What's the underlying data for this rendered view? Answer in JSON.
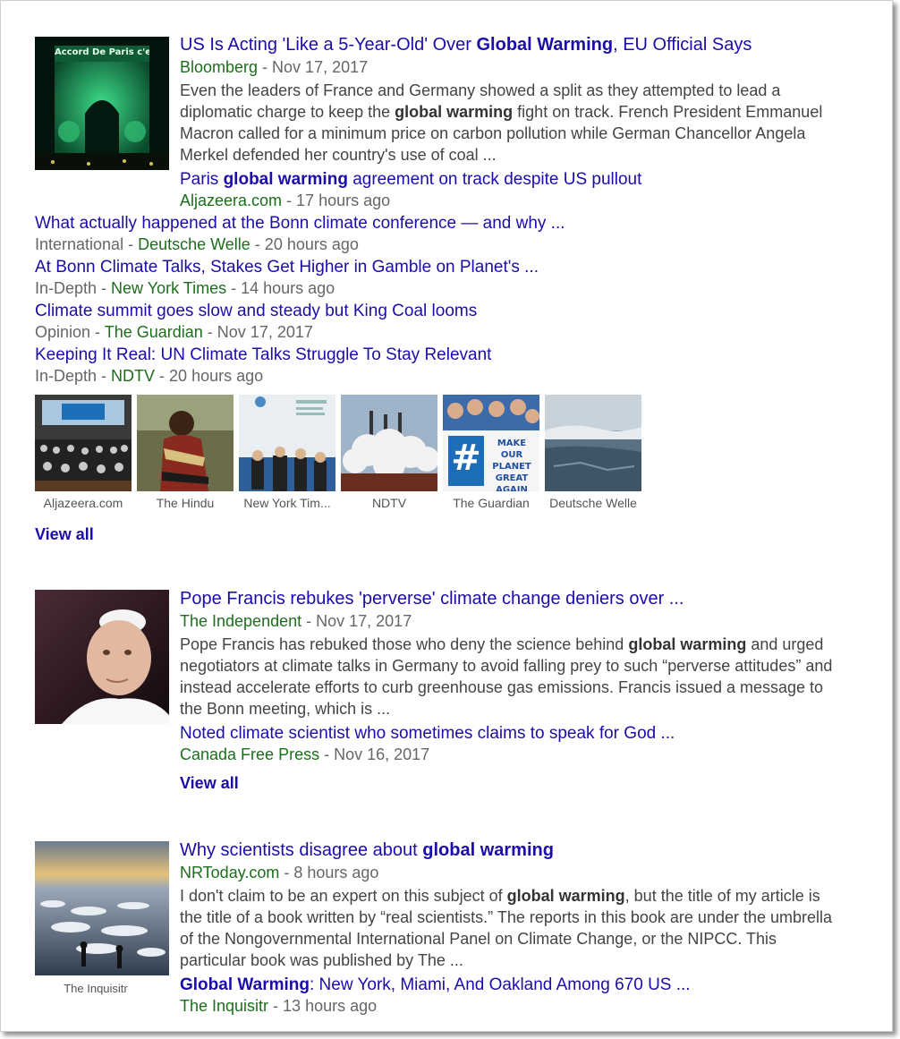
{
  "story1": {
    "title_pre": "US Is Acting 'Like a 5-Year-Old' Over ",
    "title_bold": "Global Warming",
    "title_post": ", EU Official Says",
    "publisher": "Bloomberg",
    "date": " - Nov 17, 2017",
    "snippet_1": "Even the leaders of France and Germany showed a split as they attempted to lead a diplomatic charge to keep the ",
    "snippet_bold": "global warming",
    "snippet_2": " fight on track. French President Emmanuel Macron called for a minimum price on carbon pollution while German Chancellor Angela Merkel defended her country's use of coal ...",
    "image_text": "Accord De Paris c'est fait!",
    "related_1": {
      "title_pre": "Paris ",
      "title_bold": "global warming",
      "title_post": " agreement on track despite US pullout",
      "publisher": "Aljazeera.com",
      "date": " - 17 hours ago"
    },
    "more": [
      {
        "title": "What actually happened at the Bonn climate conference — and why ...",
        "label": "International - ",
        "publisher": "Deutsche Welle",
        "date": " - 20 hours ago"
      },
      {
        "title": "At Bonn Climate Talks, Stakes Get Higher in Gamble on Planet's ...",
        "label": "In-Depth - ",
        "publisher": "New York Times",
        "date": " - 14 hours ago"
      },
      {
        "title": "Climate summit goes slow and steady but King Coal looms",
        "label": "Opinion - ",
        "publisher": "The Guardian",
        "date": " - Nov 17, 2017"
      },
      {
        "title": "Keeping It Real: UN Climate Talks Struggle To Stay Relevant",
        "label": "In-Depth - ",
        "publisher": "NDTV",
        "date": " - 20 hours ago"
      }
    ],
    "thumbs": [
      {
        "caption": "Aljazeera.com"
      },
      {
        "caption": "The Hindu"
      },
      {
        "caption": "New York Tim..."
      },
      {
        "caption": "NDTV"
      },
      {
        "caption": "The Guardian",
        "sign_text": "MAKE OUR PLANET GREAT AGAIN"
      },
      {
        "caption": "Deutsche Welle"
      }
    ],
    "view_all": "View all"
  },
  "story2": {
    "title": "Pope Francis rebukes 'perverse' climate change deniers over ...",
    "publisher": "The Independent",
    "date": " - Nov 17, 2017",
    "snippet_1": "Pope Francis has rebuked those who deny the science behind ",
    "snippet_bold": "global warming",
    "snippet_2": " and urged negotiators at climate talks in Germany to avoid falling prey to such “perverse attitudes” and instead accelerate efforts to curb greenhouse gas emissions. Francis issued a message to the Bonn meeting, which is ...",
    "related_title": "Noted climate scientist who sometimes claims to speak for God ...",
    "related_publisher": "Canada Free Press",
    "related_date": " - Nov 16, 2017",
    "view_all": "View all"
  },
  "story3": {
    "title_pre": "Why scientists disagree about ",
    "title_bold": "global warming",
    "publisher": "NRToday.com",
    "date": " - 8 hours ago",
    "snippet_1": "I don't claim to be an expert on this subject of ",
    "snippet_bold": "global warming",
    "snippet_2": ", but the title of my article is the title of a book written by “real scientists.” The reports in this book are under the umbrella of the Nongovernmental International Panel on Climate Change, or the NIPCC. This particular book was published by The ...",
    "image_caption": "The Inquisitr",
    "related_bold": "Global Warming",
    "related_post": ": New York, Miami, And Oakland Among 670 US ...",
    "related_publisher": "The Inquisitr",
    "related_date": " - 13 hours ago"
  },
  "colors": {
    "link": "#1a0dab",
    "publisher": "#1c6e1c",
    "meta": "#666666",
    "snippet": "#444444"
  }
}
